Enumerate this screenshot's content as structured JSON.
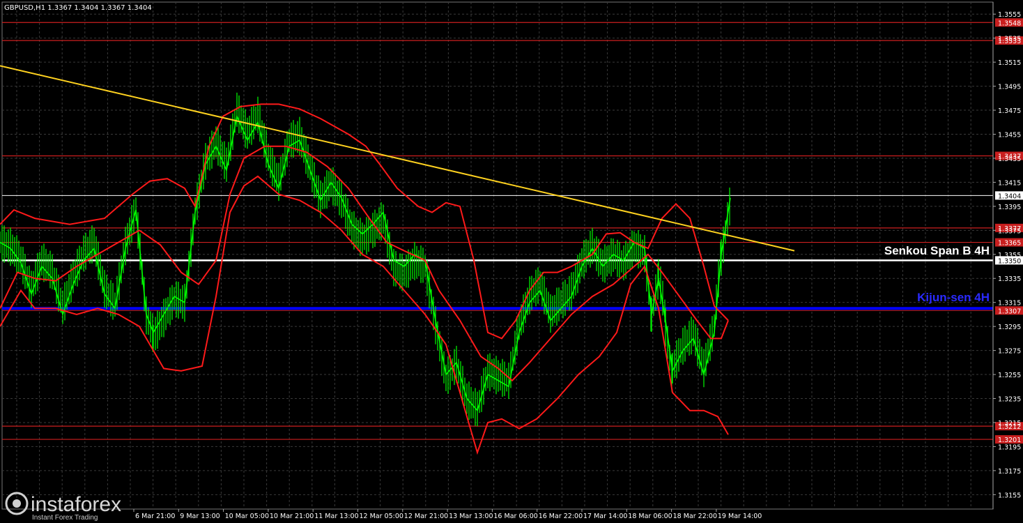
{
  "header": {
    "symbol_line": "GBPUSD,H1  1.3367 1.3404 1.3367 1.3404"
  },
  "watermark": {
    "brand": "instaforex",
    "tagline": "Instant Forex Trading"
  },
  "colors": {
    "background": "#000000",
    "grid": "#3a3a3a",
    "candles": "#00ff00",
    "bands": "#ff1a1a",
    "trendline": "#ffd21f",
    "levels": "#cc1f1f",
    "kijun": "#0000ff",
    "senkou": "#ffffff",
    "current_price": "#ffffff"
  },
  "chart_data": {
    "type": "line",
    "title": "GBPUSD,H1",
    "ylim": [
      1.3143,
      1.3565
    ],
    "y_ticks": [
      "1.3555",
      "1.3535",
      "1.3515",
      "1.3495",
      "1.3475",
      "1.3455",
      "1.3435",
      "1.3415",
      "1.3395",
      "1.3375",
      "1.3355",
      "1.3335",
      "1.3315",
      "1.3295",
      "1.3275",
      "1.3255",
      "1.3235",
      "1.3215",
      "1.3195",
      "1.3175",
      "1.3155"
    ],
    "x_ticks": [
      "6 Mar 21:00",
      "9 Mar 13:00",
      "10 Mar 05:00",
      "10 Mar 21:00",
      "11 Mar 13:00",
      "12 Mar 05:00",
      "12 Mar 21:00",
      "13 Mar 13:00",
      "16 Mar 06:00",
      "16 Mar 22:00",
      "17 Mar 14:00",
      "18 Mar 06:00",
      "18 Mar 22:00",
      "19 Mar 14:00"
    ],
    "levels": [
      {
        "value": 1.3548,
        "label": "1.3548"
      },
      {
        "value": 1.3533,
        "label": "1.3533"
      },
      {
        "value": 1.3437,
        "label": "1.3437"
      },
      {
        "value": 1.3377,
        "label": "1.3377"
      },
      {
        "value": 1.3365,
        "label": "1.3365"
      },
      {
        "value": 1.3212,
        "label": "1.3212"
      },
      {
        "value": 1.3201,
        "label": "1.3201"
      }
    ],
    "current_price": {
      "value": 1.3404,
      "label": "1.3404"
    },
    "senkou_span_b": {
      "value": 1.335,
      "label": "1.3350",
      "text": "Senkou Span B 4H"
    },
    "kijun_sen": {
      "value": 1.331,
      "label": "1.3307",
      "text": "Kijun-sen 4H"
    },
    "trendline": {
      "start": [
        0,
        1.3512
      ],
      "end": [
        1140,
        1.3358
      ]
    },
    "series": [
      {
        "role": "price",
        "points": [
          [
            0,
            1.3365
          ],
          [
            15,
            1.336
          ],
          [
            30,
            1.3348
          ],
          [
            45,
            1.3322
          ],
          [
            60,
            1.3345
          ],
          [
            75,
            1.3335
          ],
          [
            90,
            1.3305
          ],
          [
            105,
            1.333
          ],
          [
            120,
            1.335
          ],
          [
            135,
            1.336
          ],
          [
            150,
            1.3322
          ],
          [
            165,
            1.331
          ],
          [
            180,
            1.336
          ],
          [
            195,
            1.3392
          ],
          [
            210,
            1.3305
          ],
          [
            220,
            1.329
          ],
          [
            235,
            1.3305
          ],
          [
            250,
            1.332
          ],
          [
            265,
            1.3315
          ],
          [
            280,
            1.339
          ],
          [
            295,
            1.343
          ],
          [
            310,
            1.3445
          ],
          [
            325,
            1.3425
          ],
          [
            340,
            1.347
          ],
          [
            355,
            1.345
          ],
          [
            370,
            1.3465
          ],
          [
            385,
            1.343
          ],
          [
            400,
            1.341
          ],
          [
            415,
            1.3445
          ],
          [
            430,
            1.345
          ],
          [
            445,
            1.3425
          ],
          [
            460,
            1.34
          ],
          [
            475,
            1.3415
          ],
          [
            490,
            1.3402
          ],
          [
            505,
            1.338
          ],
          [
            520,
            1.3372
          ],
          [
            535,
            1.338
          ],
          [
            550,
            1.339
          ],
          [
            565,
            1.335
          ],
          [
            580,
            1.3345
          ],
          [
            595,
            1.3355
          ],
          [
            610,
            1.335
          ],
          [
            625,
            1.33
          ],
          [
            640,
            1.3255
          ],
          [
            655,
            1.3265
          ],
          [
            670,
            1.3235
          ],
          [
            685,
            1.3225
          ],
          [
            700,
            1.3255
          ],
          [
            715,
            1.325
          ],
          [
            730,
            1.3245
          ],
          [
            745,
            1.329
          ],
          [
            760,
            1.3315
          ],
          [
            775,
            1.3325
          ],
          [
            790,
            1.33
          ],
          [
            805,
            1.331
          ],
          [
            820,
            1.332
          ],
          [
            835,
            1.3345
          ],
          [
            850,
            1.336
          ],
          [
            865,
            1.3345
          ],
          [
            880,
            1.3355
          ],
          [
            895,
            1.335
          ],
          [
            910,
            1.3365
          ],
          [
            925,
            1.336
          ],
          [
            935,
            1.3305
          ],
          [
            945,
            1.3335
          ],
          [
            955,
            1.33
          ],
          [
            965,
            1.3258
          ],
          [
            980,
            1.3275
          ],
          [
            995,
            1.3285
          ],
          [
            1010,
            1.3255
          ],
          [
            1025,
            1.329
          ],
          [
            1035,
            1.3355
          ],
          [
            1048,
            1.3402
          ]
        ]
      },
      {
        "role": "upper-band",
        "points": [
          [
            0,
            1.338
          ],
          [
            20,
            1.3392
          ],
          [
            50,
            1.3385
          ],
          [
            100,
            1.338
          ],
          [
            150,
            1.3385
          ],
          [
            190,
            1.3405
          ],
          [
            215,
            1.3416
          ],
          [
            240,
            1.3418
          ],
          [
            265,
            1.341
          ],
          [
            280,
            1.3395
          ],
          [
            300,
            1.3445
          ],
          [
            320,
            1.347
          ],
          [
            345,
            1.3478
          ],
          [
            375,
            1.348
          ],
          [
            400,
            1.348
          ],
          [
            430,
            1.3476
          ],
          [
            460,
            1.3468
          ],
          [
            500,
            1.3455
          ],
          [
            525,
            1.3445
          ],
          [
            545,
            1.343
          ],
          [
            570,
            1.341
          ],
          [
            600,
            1.3395
          ],
          [
            620,
            1.339
          ],
          [
            640,
            1.3398
          ],
          [
            660,
            1.3395
          ],
          [
            680,
            1.335
          ],
          [
            700,
            1.329
          ],
          [
            720,
            1.3285
          ],
          [
            740,
            1.33
          ],
          [
            760,
            1.3325
          ],
          [
            780,
            1.334
          ],
          [
            800,
            1.334
          ],
          [
            820,
            1.3345
          ],
          [
            850,
            1.3355
          ],
          [
            870,
            1.3372
          ],
          [
            890,
            1.3373
          ],
          [
            910,
            1.3365
          ],
          [
            930,
            1.336
          ],
          [
            950,
            1.3385
          ],
          [
            970,
            1.3397
          ],
          [
            990,
            1.3385
          ],
          [
            1010,
            1.3345
          ],
          [
            1025,
            1.3312
          ],
          [
            1045,
            1.33
          ]
        ]
      },
      {
        "role": "middle-band",
        "points": [
          [
            0,
            1.331
          ],
          [
            25,
            1.334
          ],
          [
            50,
            1.3335
          ],
          [
            80,
            1.3333
          ],
          [
            110,
            1.3345
          ],
          [
            140,
            1.3355
          ],
          [
            170,
            1.3365
          ],
          [
            200,
            1.3375
          ],
          [
            230,
            1.3363
          ],
          [
            260,
            1.334
          ],
          [
            285,
            1.333
          ],
          [
            310,
            1.335
          ],
          [
            330,
            1.3405
          ],
          [
            350,
            1.3435
          ],
          [
            380,
            1.3445
          ],
          [
            410,
            1.3445
          ],
          [
            440,
            1.344
          ],
          [
            470,
            1.3428
          ],
          [
            500,
            1.341
          ],
          [
            530,
            1.3385
          ],
          [
            555,
            1.3365
          ],
          [
            580,
            1.3358
          ],
          [
            610,
            1.335
          ],
          [
            630,
            1.3325
          ],
          [
            660,
            1.33
          ],
          [
            690,
            1.327
          ],
          [
            715,
            1.326
          ],
          [
            735,
            1.325
          ],
          [
            760,
            1.3265
          ],
          [
            790,
            1.3285
          ],
          [
            820,
            1.3305
          ],
          [
            850,
            1.332
          ],
          [
            880,
            1.333
          ],
          [
            910,
            1.3345
          ],
          [
            930,
            1.3355
          ],
          [
            950,
            1.334
          ],
          [
            975,
            1.332
          ],
          [
            1000,
            1.33
          ],
          [
            1020,
            1.3285
          ],
          [
            1035,
            1.3285
          ],
          [
            1045,
            1.33
          ]
        ]
      },
      {
        "role": "lower-band",
        "points": [
          [
            0,
            1.3295
          ],
          [
            30,
            1.3325
          ],
          [
            50,
            1.331
          ],
          [
            80,
            1.331
          ],
          [
            110,
            1.3305
          ],
          [
            140,
            1.331
          ],
          [
            170,
            1.3305
          ],
          [
            200,
            1.3295
          ],
          [
            220,
            1.3275
          ],
          [
            235,
            1.326
          ],
          [
            260,
            1.3258
          ],
          [
            290,
            1.3262
          ],
          [
            310,
            1.332
          ],
          [
            330,
            1.339
          ],
          [
            350,
            1.3412
          ],
          [
            370,
            1.342
          ],
          [
            400,
            1.3405
          ],
          [
            430,
            1.34
          ],
          [
            460,
            1.339
          ],
          [
            490,
            1.3375
          ],
          [
            520,
            1.3355
          ],
          [
            550,
            1.3345
          ],
          [
            580,
            1.3325
          ],
          [
            610,
            1.3305
          ],
          [
            640,
            1.328
          ],
          [
            660,
            1.324
          ],
          [
            675,
            1.321
          ],
          [
            685,
            1.319
          ],
          [
            700,
            1.3215
          ],
          [
            720,
            1.3218
          ],
          [
            745,
            1.321
          ],
          [
            770,
            1.3218
          ],
          [
            800,
            1.3235
          ],
          [
            830,
            1.3255
          ],
          [
            860,
            1.327
          ],
          [
            885,
            1.329
          ],
          [
            905,
            1.333
          ],
          [
            925,
            1.3345
          ],
          [
            945,
            1.331
          ],
          [
            965,
            1.324
          ],
          [
            990,
            1.3225
          ],
          [
            1010,
            1.3225
          ],
          [
            1030,
            1.322
          ],
          [
            1045,
            1.3205
          ]
        ]
      }
    ]
  }
}
